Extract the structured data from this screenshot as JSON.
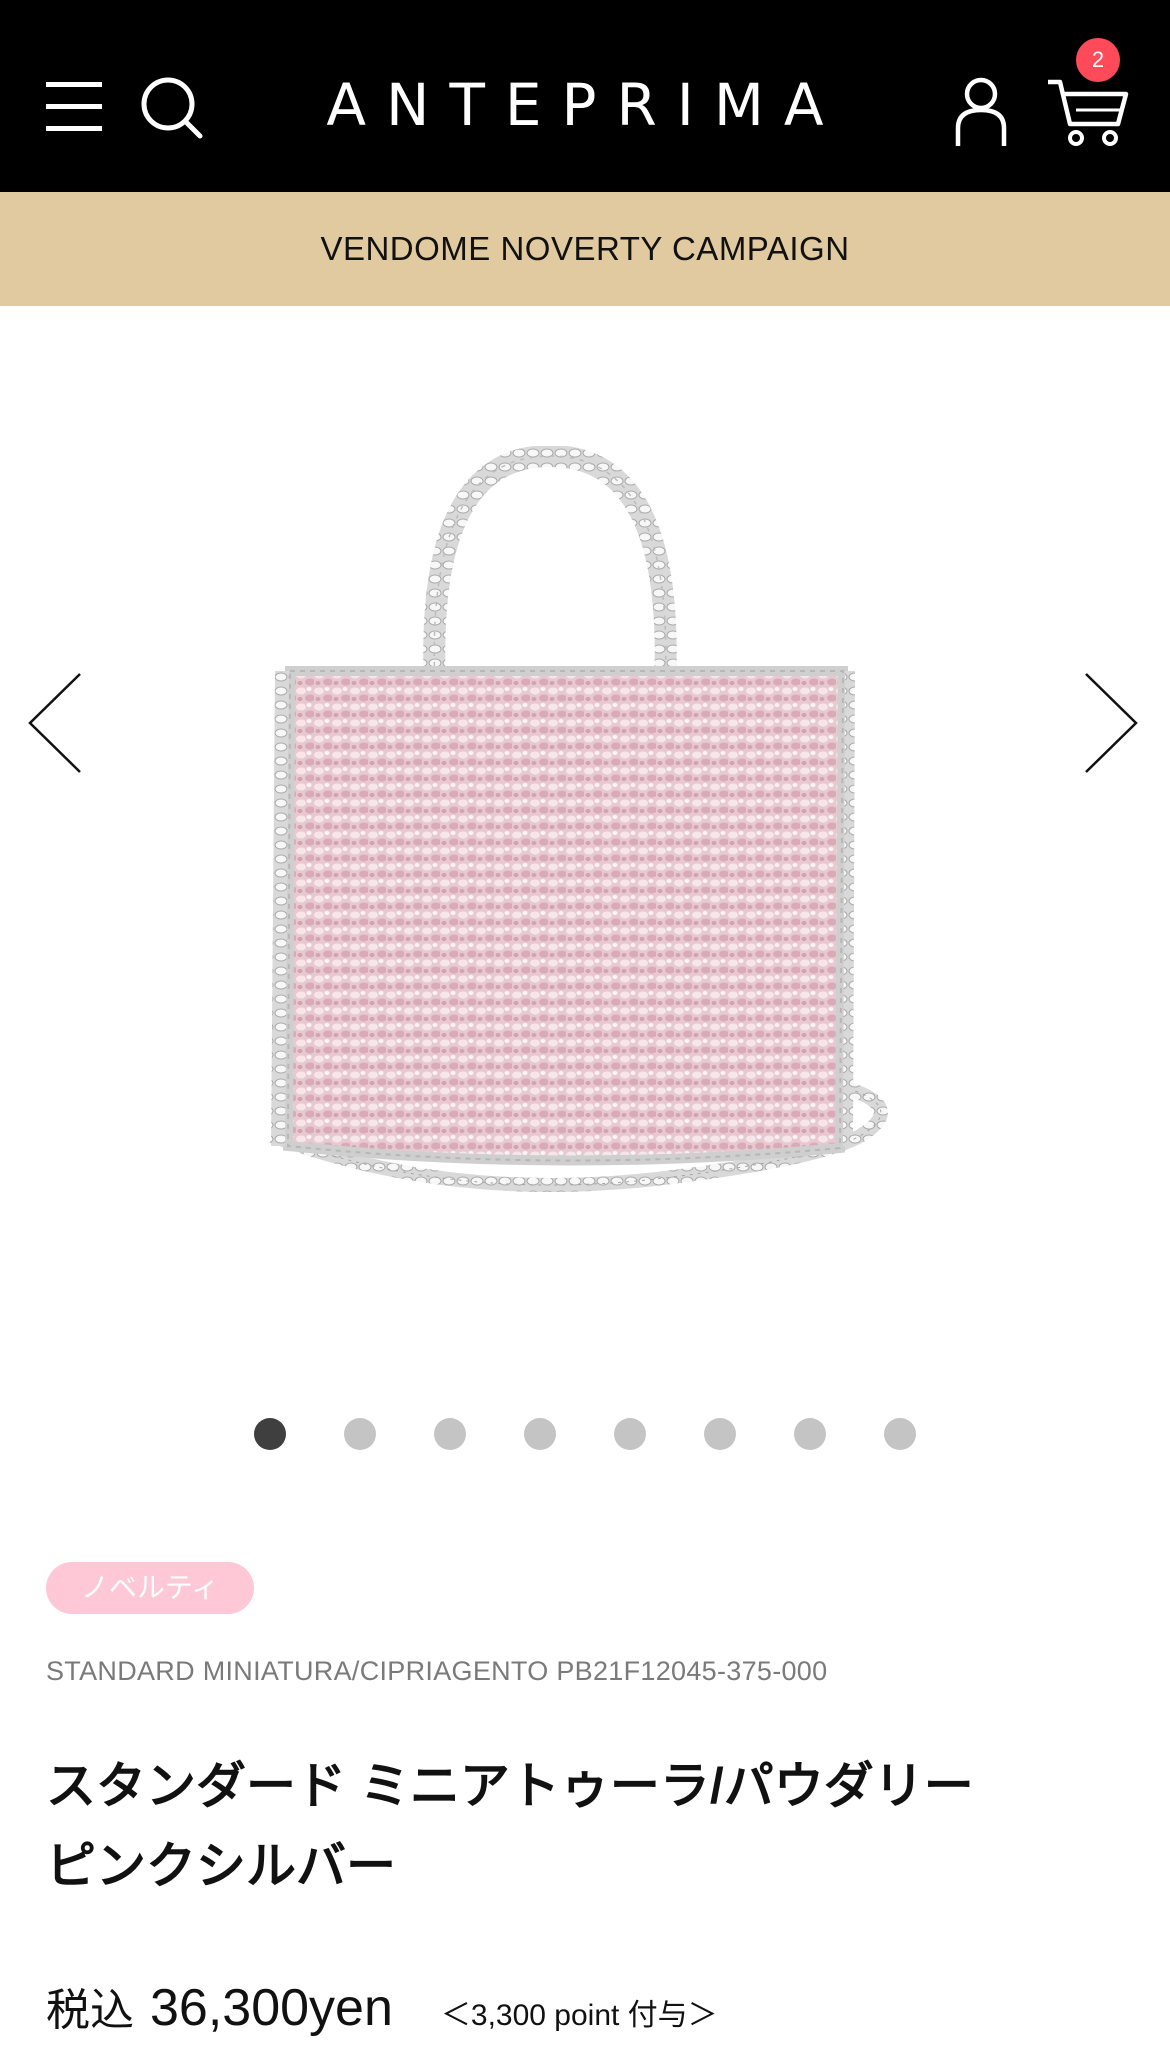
{
  "header": {
    "logo": "ANTEPRIMA",
    "cart_count": "2",
    "icons": [
      "menu-icon",
      "search-icon",
      "user-icon",
      "cart-icon"
    ]
  },
  "banner": {
    "text": "VENDOME NOVERTY CAMPAIGN"
  },
  "gallery": {
    "image_count": 8,
    "active_index": 0,
    "icons": [
      "chevron-left-icon",
      "chevron-right-icon"
    ]
  },
  "product": {
    "badge": "ノベルティ",
    "sku": "STANDARD MINIATURA/CIPRIAGENTO  PB21F12045-375-000",
    "title_line1": "スタンダード ミニアトゥーラ/パウダリー",
    "title_line2": "ピンクシルバー",
    "price_label": "税込",
    "price": "36,300yen",
    "points": "＜3,300 point 付与＞"
  },
  "colors": {
    "header_bg": "#000000",
    "banner_bg": "#e1caa0",
    "cart_badge": "#ff4a59",
    "novelty_badge": "#ffc8d6",
    "dot_active": "#3f3f3f",
    "dot_inactive": "#c4c4c4"
  }
}
